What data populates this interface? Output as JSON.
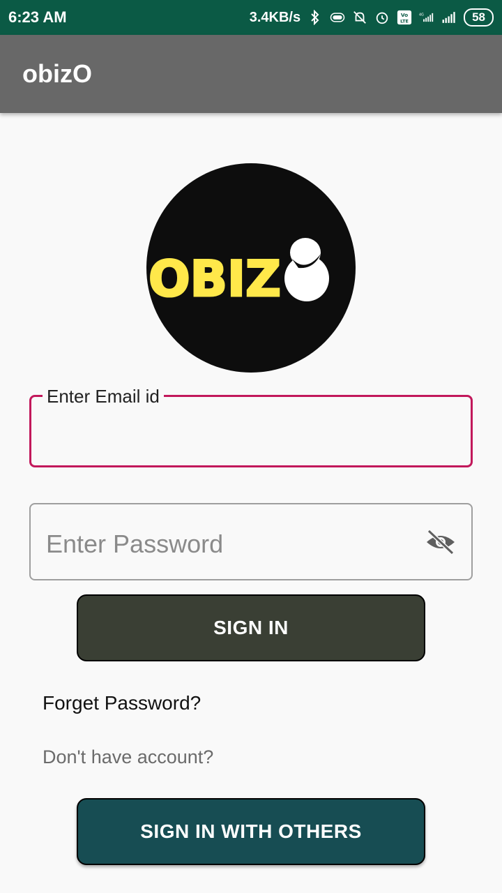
{
  "status_bar": {
    "time": "6:23 AM",
    "speed": "3.4KB/s",
    "battery": "58",
    "network_label": "4G",
    "volte_label": "Vo LTE"
  },
  "app_bar": {
    "title": "obizO"
  },
  "logo": {
    "text": "OBIZ",
    "circle_color": "#0d0d0d",
    "text_color": "#ffe84a"
  },
  "email_field": {
    "label": "Enter Email id",
    "value": "",
    "accent_color": "#c2185b"
  },
  "password_field": {
    "placeholder": "Enter Password",
    "value": "",
    "toggle_icon": "eye-off-icon"
  },
  "sign_in_button": {
    "label": "SIGN IN"
  },
  "forget_password": {
    "label": "Forget Password?"
  },
  "no_account": {
    "label": "Don't have account?"
  },
  "sign_in_others_button": {
    "label": "SIGN IN WITH OTHERS"
  }
}
